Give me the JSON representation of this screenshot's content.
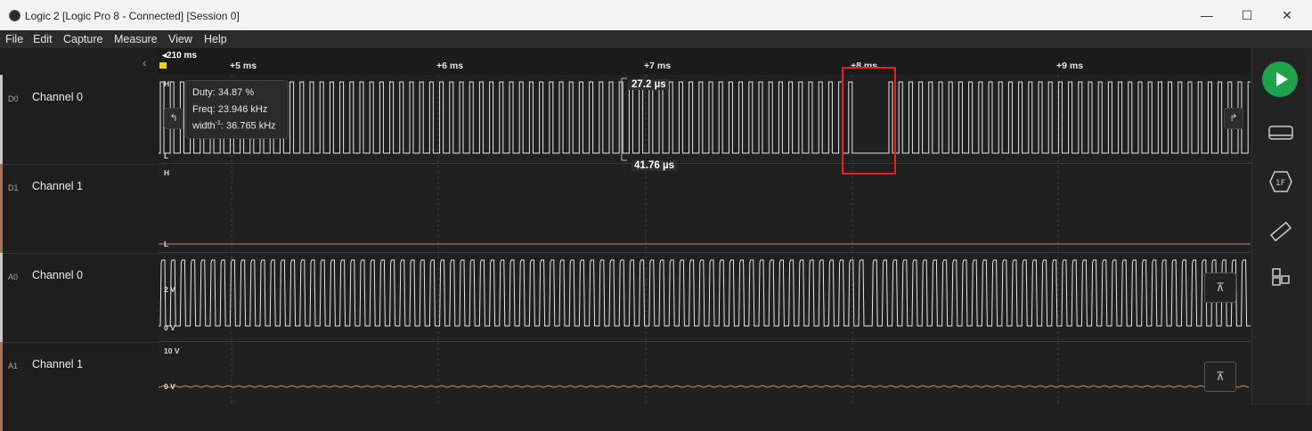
{
  "window": {
    "title": "Logic 2 [Logic Pro 8 - Connected] [Session 0]",
    "controls": {
      "minimize": "—",
      "maximize": "☐",
      "close": "✕"
    }
  },
  "menu": {
    "items": [
      "File",
      "Edit",
      "Capture",
      "Measure",
      "View",
      "Help"
    ]
  },
  "timeline": {
    "offset_label": "210 ms",
    "ticks": [
      "+5 ms",
      "+6 ms",
      "+7 ms",
      "+8 ms",
      "+9 ms"
    ]
  },
  "channels": [
    {
      "chip": "D0",
      "name": "Channel 0",
      "accent": "#c8c8c8"
    },
    {
      "chip": "D1",
      "name": "Channel 1",
      "accent": "#a5715a"
    },
    {
      "chip": "A0",
      "name": "Channel 0",
      "accent": "#c8c8c8"
    },
    {
      "chip": "A1",
      "name": "Channel 1",
      "accent": "#a5715a"
    }
  ],
  "levels": {
    "d_high": "H",
    "d_low": "L",
    "a0_high": "2 V",
    "a0_low": "0 V",
    "a1_high": "10 V",
    "a1_low": "0 V"
  },
  "tooltip": {
    "duty": "Duty: 34.87 %",
    "freq": "Freq: 23.946 kHz",
    "width_prefix": "width",
    "width_sup": "-1",
    "width_value": ": 36.765 kHz"
  },
  "measurements": {
    "pulse_width": "27.2 µs",
    "period": "41.76 µs"
  },
  "sidebar_icons": [
    "play-icon",
    "analyzers-icon",
    "measurements-icon",
    "timing-markers-icon",
    "extensions-icon"
  ],
  "colors": {
    "accent_green": "#1fa34a",
    "highlight_red": "#e3231f",
    "analog_orange": "#d48a5f"
  }
}
